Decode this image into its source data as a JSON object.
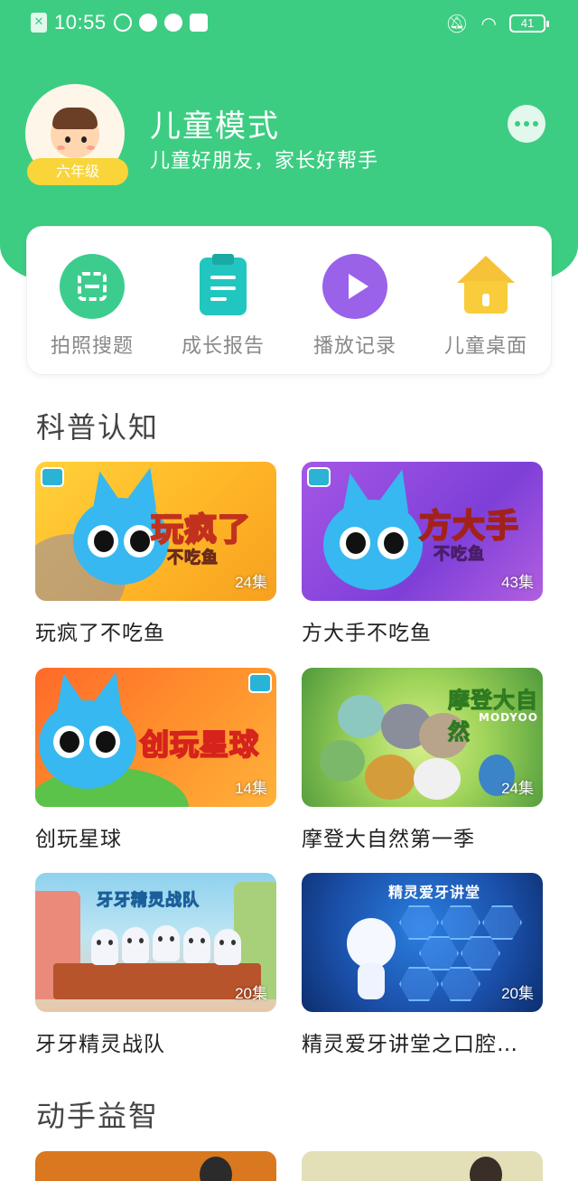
{
  "status_bar": {
    "time": "10:55",
    "battery": "41"
  },
  "profile": {
    "grade": "六年级",
    "title": "儿童模式",
    "subtitle": "儿童好朋友，家长好帮手"
  },
  "tools": [
    {
      "label": "拍照搜题",
      "icon": "scan-icon",
      "color": "#3ccd8e"
    },
    {
      "label": "成长报告",
      "icon": "clipboard-icon",
      "color": "#22c6c0"
    },
    {
      "label": "播放记录",
      "icon": "play-icon",
      "color": "#9962e8"
    },
    {
      "label": "儿童桌面",
      "icon": "home-icon",
      "color": "#f6c338"
    }
  ],
  "sections": [
    {
      "title": "科普认知",
      "items": [
        {
          "title": "玩疯了不吃鱼",
          "episodes": "24集",
          "art_text": "玩疯了",
          "art_sub": "不吃鱼"
        },
        {
          "title": "方大手不吃鱼",
          "episodes": "43集",
          "art_text": "方大手",
          "art_sub": "不吃鱼"
        },
        {
          "title": "创玩星球",
          "episodes": "14集",
          "art_text": "创玩星球"
        },
        {
          "title": "摩登大自然第一季",
          "episodes": "24集",
          "art_text": "摩登大自然",
          "art_sub": "MODYOO"
        },
        {
          "title": "牙牙精灵战队",
          "episodes": "20集",
          "art_text": "牙牙精灵战队"
        },
        {
          "title": "精灵爱牙讲堂之口腔…",
          "episodes": "20集",
          "art_text": "精灵爱牙讲堂"
        }
      ]
    },
    {
      "title": "动手益智"
    }
  ],
  "colors": {
    "primary": "#3dcd82",
    "badge": "#f9d53a"
  }
}
